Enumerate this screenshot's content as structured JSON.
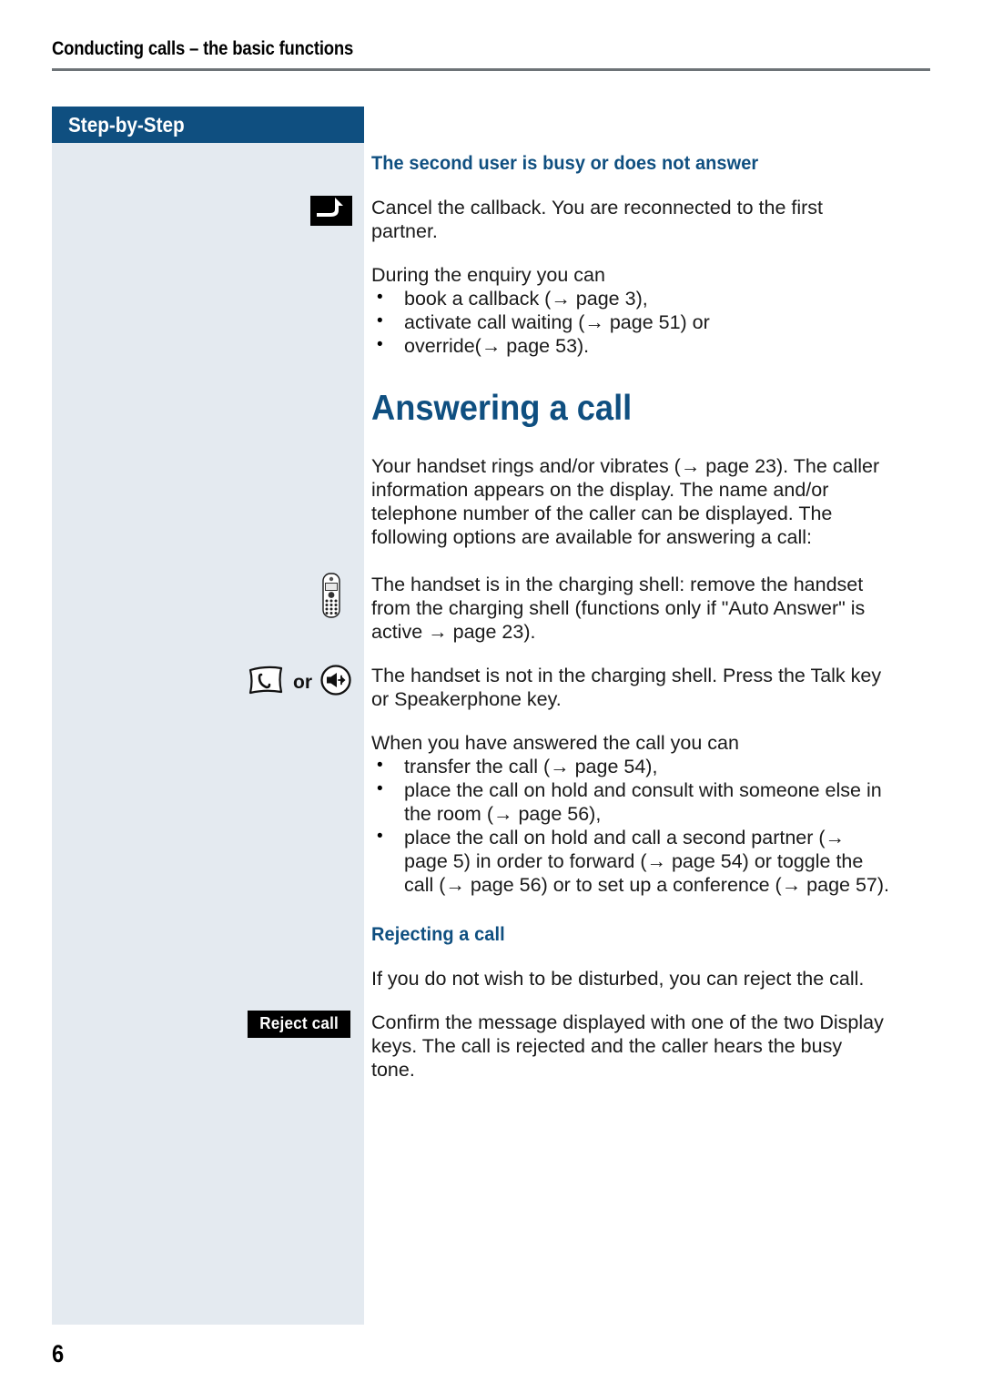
{
  "header": {
    "running_title": "Conducting calls – the basic functions"
  },
  "sidebar": {
    "banner_label": "Step-by-Step"
  },
  "footer": {
    "page_number": "6"
  },
  "colors": {
    "heading_blue": "#0f4f80",
    "banner_blue": "#0f4f80",
    "sidebar_bg": "#e4eaf0",
    "rule_gray": "#6d7377",
    "display_key_bg": "#000000"
  },
  "sections": {
    "second_user": {
      "heading": "The second user is busy or does not answer",
      "icon": "return-key-icon",
      "paragraph": "Cancel the callback. You are reconnected to the first partner.",
      "list_intro": "During the enquiry you can",
      "bullets": [
        "book a callback (→ page 3),",
        "activate call waiting (→ page 51) or",
        "override(→ page 53)."
      ]
    },
    "answering": {
      "heading": "Answering a call",
      "intro": "Your handset rings and/or vibrates (→ page 23). The caller information appears on the display. The name and/or telephone number of the caller can be displayed. The following options are available for answering a call:",
      "option_charging_shell": {
        "icon": "handset-icon",
        "text": "The handset is in the charging shell: remove the handset from the charging shell (functions only if \"Auto Answer\" is active → page 23)."
      },
      "option_keys": {
        "icon_talk": "talk-key-icon",
        "or_label": "or",
        "icon_speaker": "speakerphone-key-icon",
        "text": "The handset is not in the charging shell. Press the Talk key or Speakerphone key."
      },
      "list_intro": "When you have answered the call you can",
      "bullets": [
        "transfer the call (→ page 54),",
        "place the call on hold and consult with someone else in the room (→ page 56),",
        "place the call on hold and call a second partner (→ page 5) in order to forward (→ page 54) or toggle the call (→ page 56) or to set up a conference (→ page 57)."
      ]
    },
    "rejecting": {
      "heading": "Rejecting a call",
      "paragraph": "If you do not wish to be disturbed, you can reject the call.",
      "display_key_label": "Reject call",
      "paragraph_key": "Confirm the message displayed with one of the two Display keys. The call is rejected and the caller hears the busy tone."
    }
  }
}
